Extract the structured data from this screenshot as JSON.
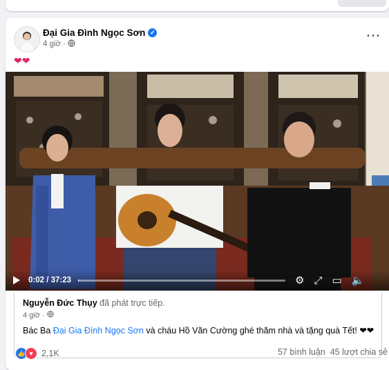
{
  "post": {
    "author": "Đại Gia Đình Ngọc Sơn",
    "time": "4 giờ",
    "caption": "❤❤",
    "video": {
      "current_time": "0:02",
      "duration": "37:23",
      "progress": 0.001
    },
    "shared": {
      "name": "Nguyễn Đức Thụy",
      "action": " đã phát trực tiếp.",
      "time": "4 giờ",
      "text_prefix": "Bác Ba ",
      "text_link": "Đại Gia Đình Ngọc Sơn",
      "text_suffix": " và cháu Hồ Văn Cường ghé thăm nhà và tặng quà Tết! ❤❤"
    },
    "reactions_count": "2,1K",
    "comments": "57 bình luận",
    "shares": "45 lượt chia sẻ"
  },
  "colors": {
    "accent": "#1877f2",
    "love": "#f33e58"
  }
}
